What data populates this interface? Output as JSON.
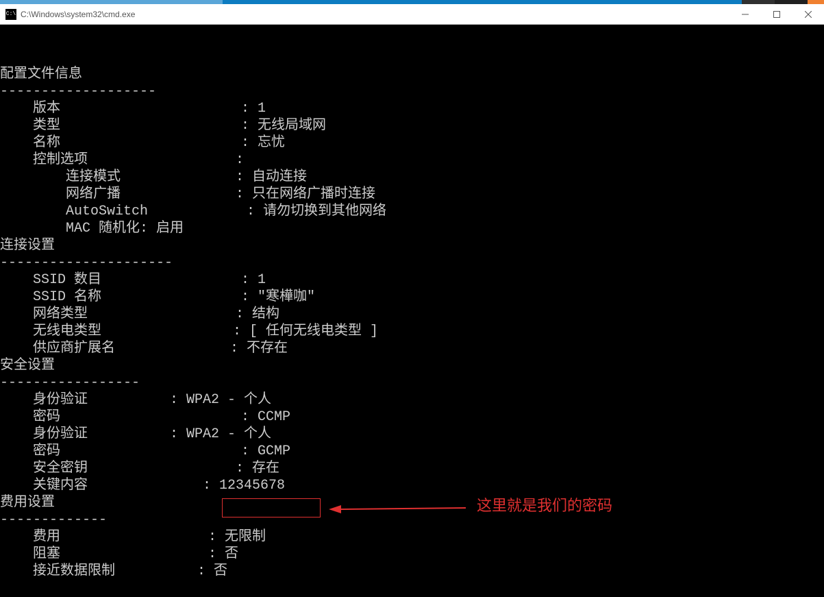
{
  "window": {
    "icon_text": "C:\\",
    "title": "C:\\Windows\\system32\\cmd.exe"
  },
  "topbar_colors": [
    "#5aa6d8",
    "#5aa6d8",
    "#5aa6d8",
    "#0d7cc1",
    "#0d7cc1",
    "#0d7cc1",
    "#0d7cc1",
    "#0d7cc1",
    "#0d7cc1",
    "#0d7cc1",
    "#303030",
    "#202020",
    "#f08030"
  ],
  "sections": {
    "profile": {
      "header": "配置文件信息",
      "divider": "-------------------",
      "rows": [
        {
          "label": "    版本",
          "value": "1",
          "colon_col": 30
        },
        {
          "label": "    类型",
          "value": "无线局域网",
          "colon_col": 30
        },
        {
          "label": "    名称",
          "value": "忘忧",
          "colon_col": 30
        },
        {
          "label": "    控制选项",
          "value": "",
          "colon_col": 30
        },
        {
          "label": "        连接模式",
          "value": "自动连接",
          "colon_col": 30
        },
        {
          "label": "        网络广播",
          "value": "只在网络广播时连接",
          "colon_col": 30
        },
        {
          "label": "        AutoSwitch",
          "value": "请勿切换到其他网络",
          "colon_col": 30
        },
        {
          "label": "        MAC 随机化: 启用",
          "value": null,
          "colon_col": null
        }
      ]
    },
    "conn": {
      "header": "连接设置",
      "divider": "---------------------",
      "rows": [
        {
          "label": "    SSID 数目",
          "value": "1",
          "colon_col": 30
        },
        {
          "label": "    SSID 名称",
          "value": "\"寒樺咖\"",
          "colon_col": 30
        },
        {
          "label": "    网络类型",
          "value": "结构",
          "colon_col": 30
        },
        {
          "label": "    无线电类型",
          "value": "[ 任何无线电类型 ]",
          "colon_col": 30
        },
        {
          "label": "    供应商扩展名",
          "value": "不存在",
          "colon_col": 30
        }
      ]
    },
    "security": {
      "header": "安全设置",
      "divider": "-----------------",
      "rows": [
        {
          "label": "    身份验证",
          "value": "WPA2 - 个人",
          "colon_col": 22
        },
        {
          "label": "    密码",
          "value": "CCMP",
          "colon_col": 30
        },
        {
          "label": "    身份验证",
          "value": "WPA2 - 个人",
          "colon_col": 22
        },
        {
          "label": "    密码",
          "value": "GCMP",
          "colon_col": 30
        },
        {
          "label": "    安全密钥",
          "value": "存在",
          "colon_col": 30
        },
        {
          "label": "    关键内容",
          "value": "12345678",
          "colon_col": 26
        }
      ]
    },
    "cost": {
      "header": "费用设置",
      "divider": "-------------",
      "rows": [
        {
          "label": "    费用",
          "value": "无限制",
          "colon_col": 26
        },
        {
          "label": "    阻塞",
          "value": "否",
          "colon_col": 26
        },
        {
          "label": "    接近数据限制",
          "value": "否",
          "colon_col": 26
        }
      ]
    }
  },
  "annotation": "这里就是我们的密码"
}
